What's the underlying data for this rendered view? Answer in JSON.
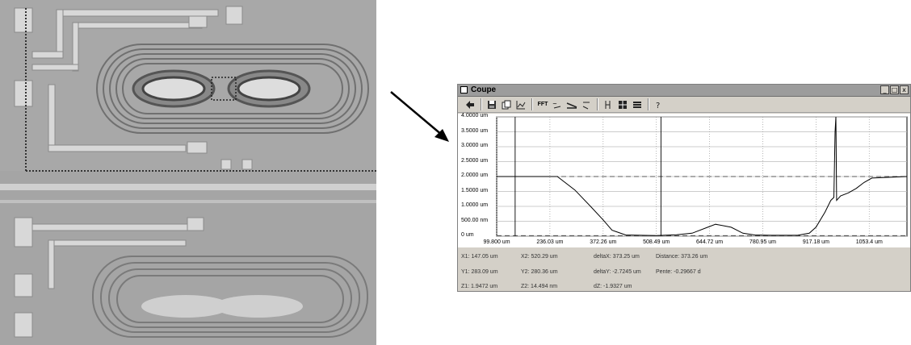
{
  "window": {
    "title": "Coupe",
    "controls": [
      "_",
      "□",
      "x"
    ]
  },
  "toolbar": {
    "fft_label": "FFT"
  },
  "chart_data": {
    "type": "line",
    "y_ticks": [
      "4.0000 um",
      "3.5000 um",
      "3.0000 um",
      "2.5000 um",
      "2.0000 um",
      "1.5000 um",
      "1.0000 um",
      "500.00 nm",
      "0 um"
    ],
    "x_ticks": [
      "99.800 um",
      "236.03 um",
      "372.26 um",
      "508.49 um",
      "644.72 um",
      "780.95 um",
      "917.18 um",
      "1053.4 um"
    ],
    "ylim": [
      0,
      4
    ],
    "xlim": [
      99.8,
      1150
    ],
    "grid": true,
    "series": [
      {
        "x": [
          99.8,
          230,
          255,
          300,
          340,
          372,
          395,
          430,
          508,
          560,
          600,
          640,
          660,
          700,
          730,
          760,
          800,
          840,
          870,
          900,
          917,
          940,
          955,
          963,
          966,
          968,
          970,
          980,
          1000,
          1020,
          1040,
          1060,
          1150
        ],
        "y": [
          2.0,
          2.0,
          2.0,
          1.55,
          1.0,
          0.55,
          0.2,
          0.04,
          0.02,
          0.05,
          0.1,
          0.3,
          0.4,
          0.3,
          0.1,
          0.04,
          0.03,
          0.03,
          0.03,
          0.1,
          0.3,
          0.8,
          1.2,
          1.3,
          3.5,
          4.0,
          1.2,
          1.35,
          1.45,
          1.6,
          1.8,
          1.95,
          2.0
        ]
      }
    ],
    "cursor_x": [
      147.05,
      520.29
    ],
    "reference_levels": [
      2.0,
      0.02
    ]
  },
  "readout": {
    "x1": "X1: 147.05 um",
    "x2": "X2: 520.29 um",
    "deltax": "deltaX: 373.25 um",
    "distance": "Distance: 373.26 um",
    "y1": "Y1: 283.09 um",
    "y2": "Y2: 280.36 um",
    "deltay": "deltaY: -2.7245 um",
    "pente": "Pente: -0.29667 d",
    "z1": "Z1: 1.9472 um",
    "z2": "Z2: 14.494 nm",
    "dz": "dZ: -1.9327 um"
  },
  "colors": {
    "micrograph_bg": "#a5a5a5",
    "window_face": "#d4d0c8",
    "titlebar": "#9c9c9c"
  }
}
